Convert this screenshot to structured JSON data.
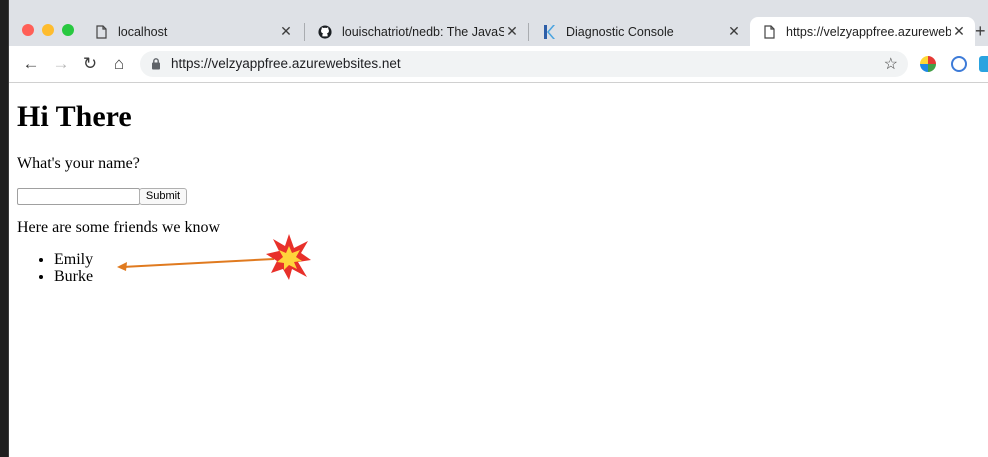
{
  "browser": {
    "tabs": [
      {
        "title": "localhost",
        "icon": "document-icon"
      },
      {
        "title": "louischatriot/nedb: The JavaSc",
        "icon": "github-icon"
      },
      {
        "title": "Diagnostic Console",
        "icon": "kudu-icon"
      },
      {
        "title": "https://velzyappfree.azureweb",
        "icon": "document-icon",
        "active": true
      }
    ],
    "close_glyph": "✕",
    "new_tab_glyph": "+",
    "address": {
      "url": "https://velzyappfree.azurewebsites.net"
    },
    "nav": {
      "back": "←",
      "forward": "→",
      "reload": "↻",
      "home": "⌂",
      "bookmark": "☆"
    }
  },
  "page": {
    "heading": "Hi There",
    "question": "What's your name?",
    "name_value": "",
    "submit_label": "Submit",
    "friends_heading": "Here are some friends we know",
    "friends": [
      "Emily",
      "Burke"
    ]
  },
  "annotation": {
    "arrow_color": "#e07a1f",
    "burst_color": "#e8302a",
    "burst_core": "#ffd43b"
  }
}
